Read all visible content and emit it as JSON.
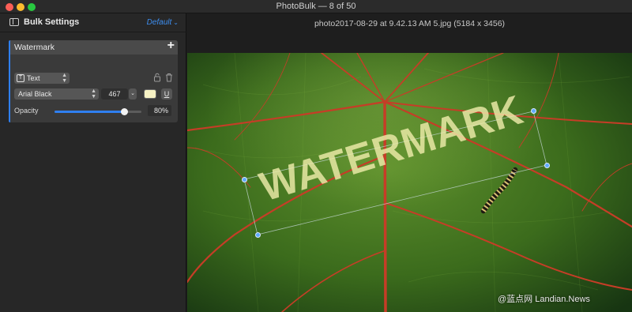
{
  "window": {
    "title": "PhotoBulk — 8 of 50"
  },
  "sidebar": {
    "title": "Bulk Settings",
    "preset": "Default",
    "panel": {
      "title": "Watermark",
      "add_label": "+",
      "type": "Text",
      "font": "Arial Black",
      "size": "467",
      "color": "#f7f2c4",
      "underline": "U",
      "opacity_label": "Opacity",
      "opacity_value": "80%",
      "opacity_fraction": 0.8
    }
  },
  "main": {
    "file_name": "photo2017-08-29 at 9.42.13 AM 5.jpg (5184 x 3456)",
    "watermark_text": "WATERMARK",
    "credit": "@蓝点网 Landian.News"
  },
  "colors": {
    "accent": "#2f7ff0",
    "leaf": "#3d6e1e",
    "vein": "#c8442a"
  }
}
